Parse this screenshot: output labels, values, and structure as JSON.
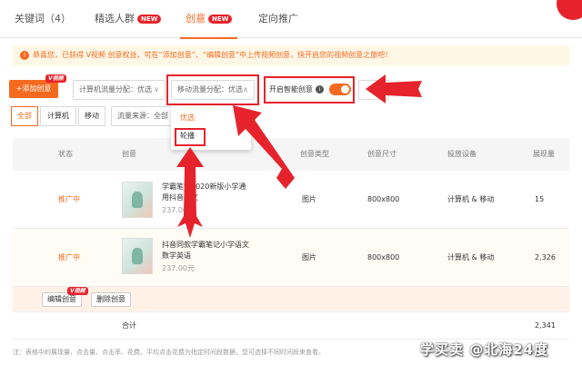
{
  "tabs": [
    {
      "label": "关键词（4）"
    },
    {
      "label": "精选人群",
      "badge": "NEW"
    },
    {
      "label": "创意",
      "badge": "NEW"
    },
    {
      "label": "定向推广"
    }
  ],
  "notice": {
    "text": "恭喜您，已获得 V视频 创意权益，可在“添加创意”、“编辑创意”中上传视频创意，快开启您的视频创意之旅吧！"
  },
  "toolbar": {
    "add_label": "+添加创意",
    "video_badge": "V视频",
    "pc_flow_label": "计算机流量分配：优选",
    "mobile_flow_label": "移动流量分配：优选",
    "smart_label": "开启智能创意",
    "smart_on": true
  },
  "filters": {
    "segments": [
      "全部",
      "计算机",
      "移动"
    ],
    "source_label": "流量来源：全部"
  },
  "dropdown": {
    "options": [
      "优选",
      "轮播"
    ],
    "selected": "优选"
  },
  "table": {
    "headers": [
      "状态",
      "创意",
      "创意类型",
      "创意尺寸",
      "投放设备",
      "展现量"
    ],
    "rows": [
      {
        "status": "推广中",
        "title_1": "学霸笔记2020新版小学通",
        "title_2": "用抖音热文",
        "price": "237.00元",
        "type": "图片",
        "size": "800x800",
        "device": "计算机 & 移动",
        "impressions": "15"
      },
      {
        "status": "推广中",
        "title_1": "抖音同款学霸笔记小学语文",
        "title_2": "数学英语",
        "price": "237.00元",
        "type": "图片",
        "size": "800x800",
        "device": "计算机 & 移动",
        "impressions": "2,326"
      }
    ],
    "actions": {
      "edit": "编辑创意",
      "delete": "删除创意"
    },
    "total_label": "合计",
    "total_value": "2,341"
  },
  "footnote": "注：表格中的展现量、点击量、点击率、花费、平均点击花费为指定时间段数据，您可选择不同时间段来查看。",
  "watermark": "学买卖 @北海24度",
  "colors": {
    "accent": "#f46a1f",
    "highlight": "#e6232c"
  }
}
